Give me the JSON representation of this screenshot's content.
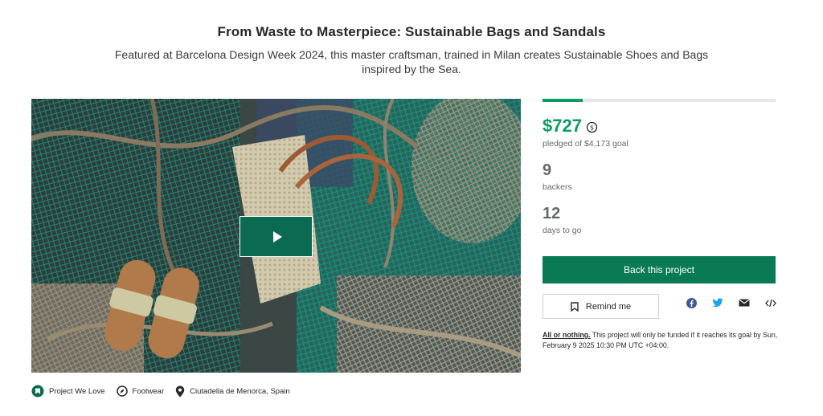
{
  "header": {
    "title": "From Waste to Masterpiece: Sustainable Bags and Sandals",
    "subtitle": "Featured at Barcelona Design Week 2024, this master craftsman, trained in Milan creates Sustainable Shoes and Bags inspired by the Sea."
  },
  "media": {
    "play_icon": "play-icon",
    "play_color": "#0a6b52"
  },
  "tags": [
    {
      "label": "Project We Love",
      "icon": "project-we-love-icon"
    },
    {
      "label": "Footwear",
      "icon": "compass-icon"
    },
    {
      "label": "Ciutadella de Menorca, Spain",
      "icon": "location-pin-icon"
    }
  ],
  "campaign": {
    "funded_fraction": 0.174,
    "pledged": "$727",
    "pledged_goal": "pledged of $4,173 goal",
    "backers_count": "9",
    "backers_label": "backers",
    "days_count": "12",
    "days_label": "days to go",
    "accent_color": "#0b9c64"
  },
  "actions": {
    "back_label": "Back this project",
    "remind_label": "Remind me",
    "share": [
      "facebook-icon",
      "twitter-icon",
      "email-icon",
      "embed-icon"
    ]
  },
  "terms": {
    "link": "All or nothing.",
    "text": " This project will only be funded if it reaches its goal by Sun, February 9 2025 10:30 PM UTC +04:00."
  }
}
